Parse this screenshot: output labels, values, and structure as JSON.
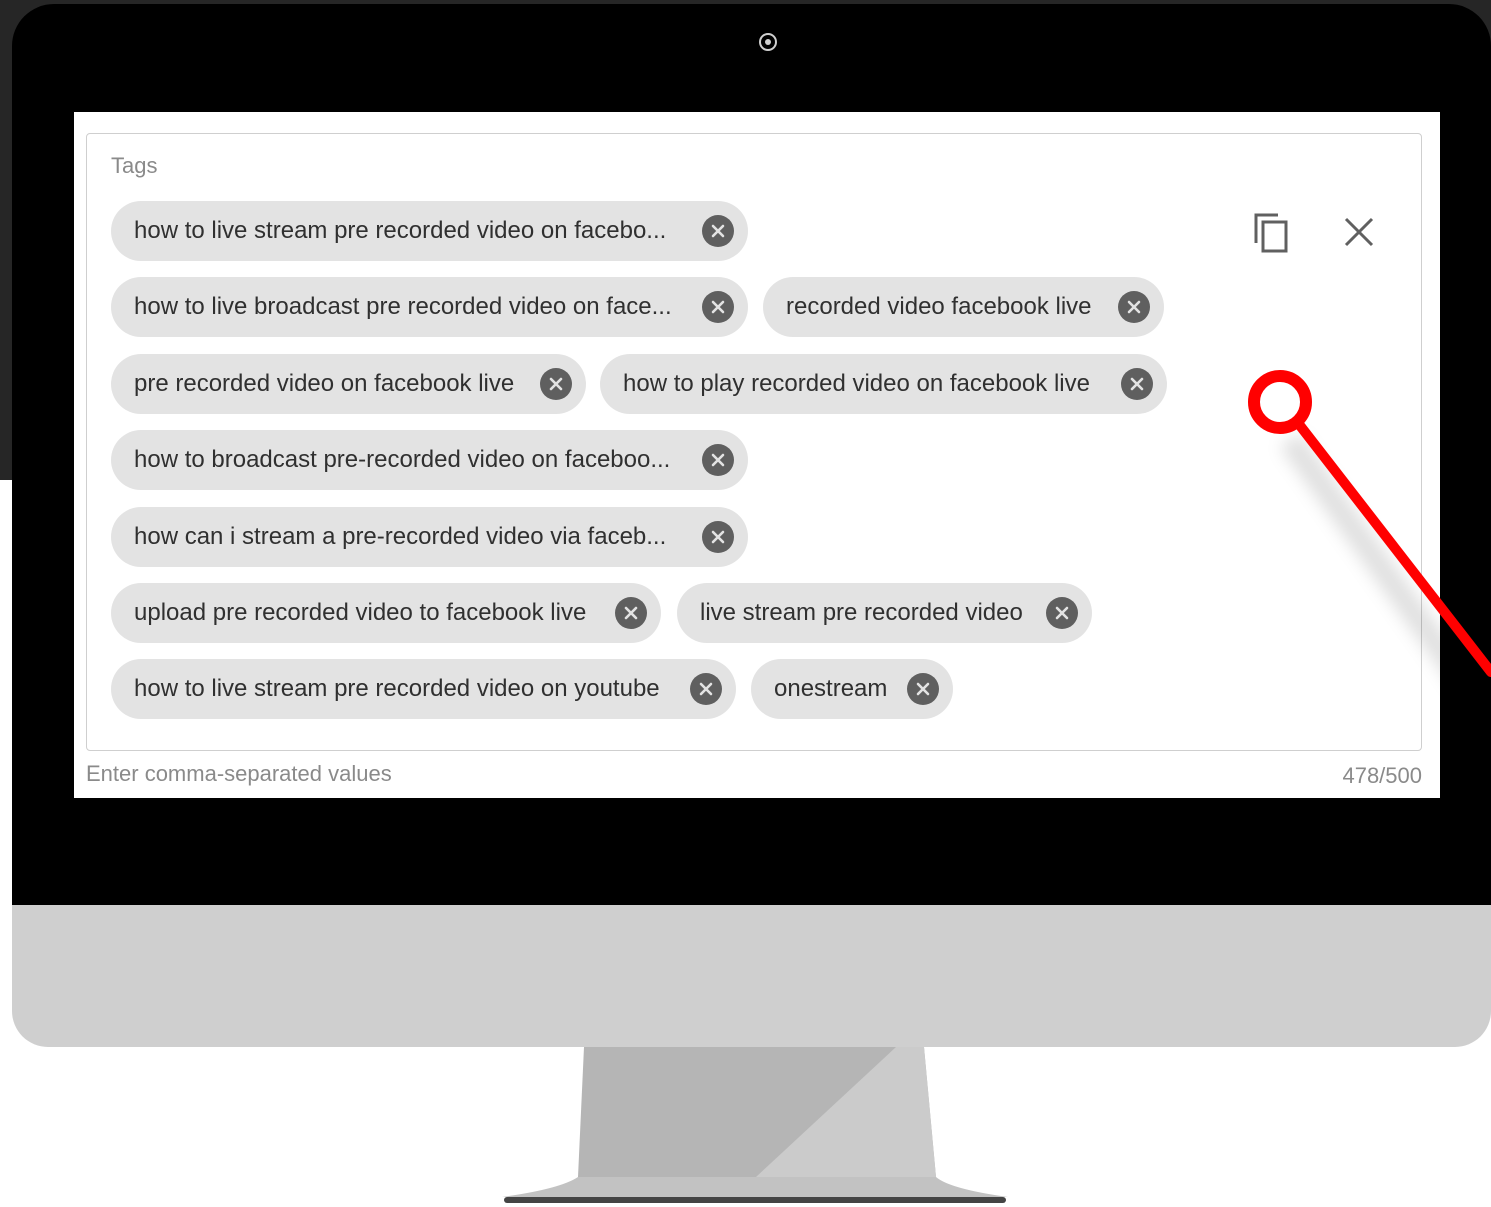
{
  "tags_field": {
    "label": "Tags",
    "hint": "Enter comma-separated values",
    "counter": "478/500",
    "tags": [
      "how to live stream pre recorded video on facebo...",
      "how to live broadcast pre recorded video on face...",
      "recorded video facebook live",
      "pre recorded video on facebook live",
      "how to play recorded video on facebook live",
      "how to broadcast pre-recorded video on faceboo...",
      "how can i stream a pre-recorded video via faceb...",
      "upload pre recorded video to facebook live",
      "live stream pre recorded video",
      "how to live stream pre recorded video on youtube",
      "onestream"
    ],
    "actions": {
      "copy": "copy-icon",
      "clear": "close-icon"
    }
  },
  "colors": {
    "chip_bg": "#e3e3e3",
    "chip_close": "#5f5f5f",
    "annotation": "#ff0000",
    "bezel": "#000000",
    "chin": "#cfcfcf"
  }
}
